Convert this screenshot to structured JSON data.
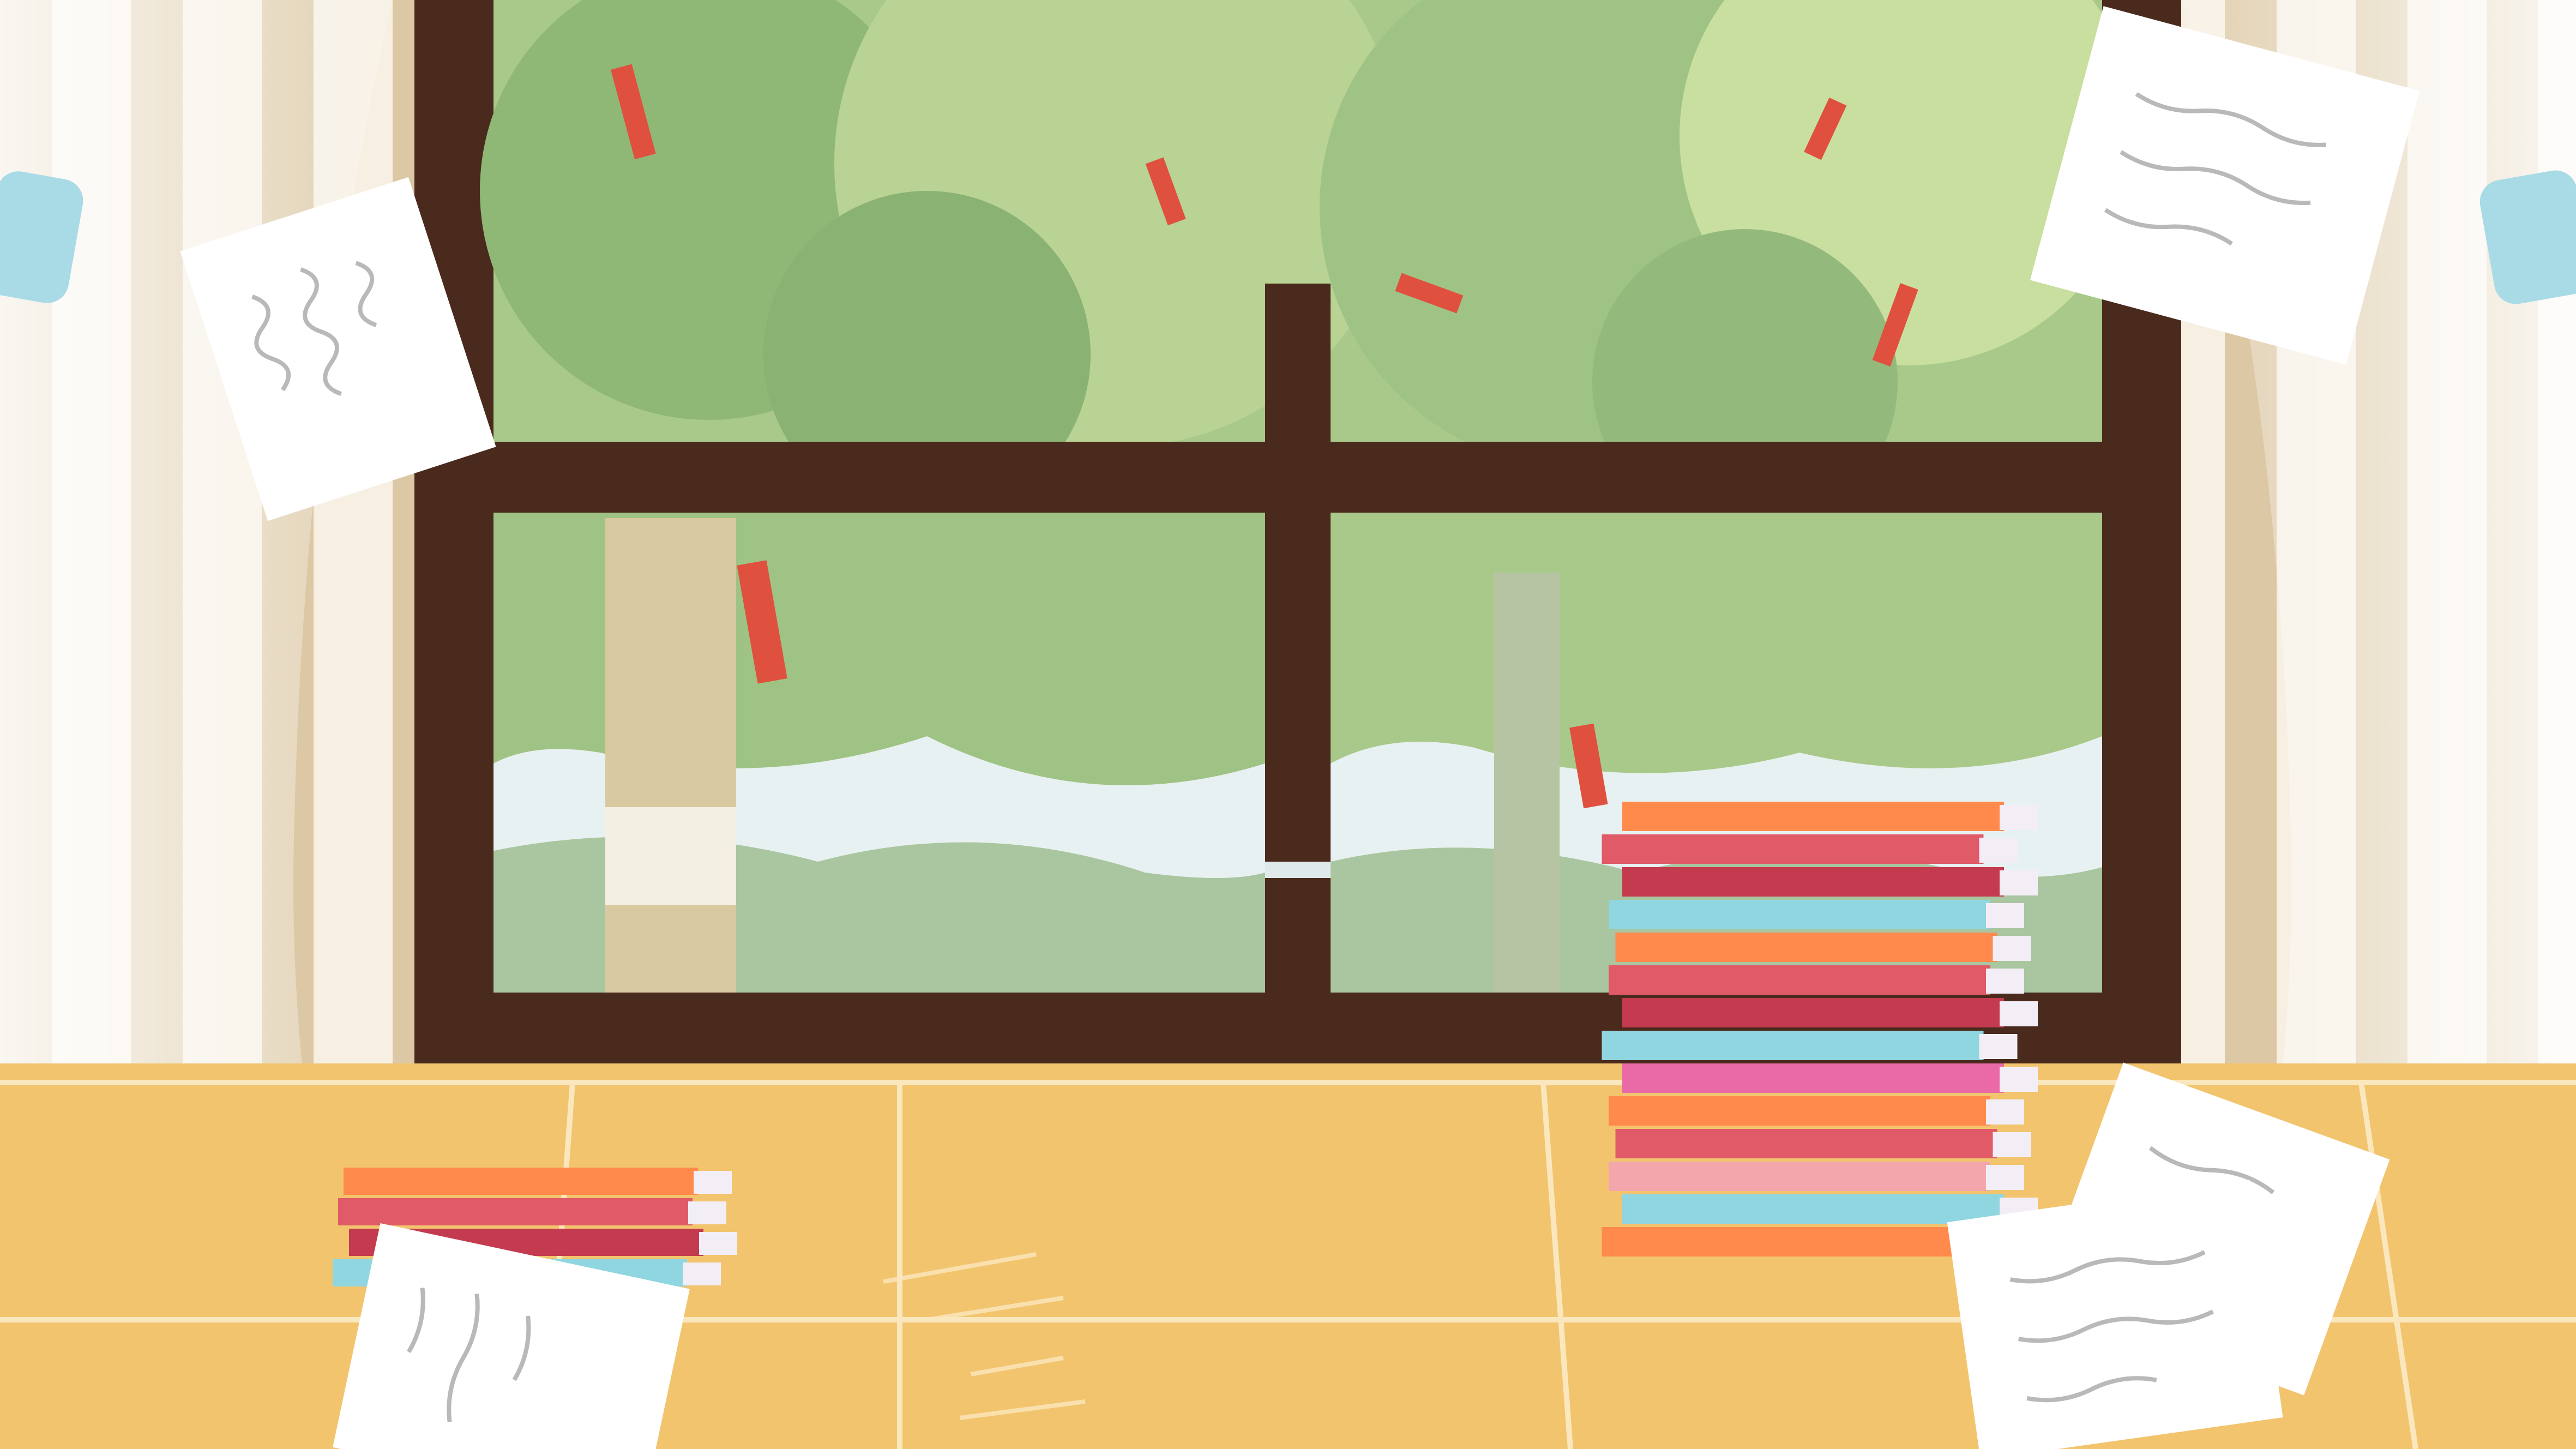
{
  "scene": {
    "description_free": true,
    "palette": {
      "wall_light": "#f6efe2",
      "wall_stripe": "#d9c4a0",
      "frame": "#4a2a1c",
      "glass_sky": "#e8f1f1",
      "foliage_dark": "#7fa86e",
      "foliage_mid": "#a8c98a",
      "foliage_light": "#cfe2a8",
      "trunk": "#d9c9a0",
      "ribbon": "#e0503e",
      "floor": "#f2c46e",
      "floor_line": "#fbe7bd",
      "curtain_tie": "#a9dbe6",
      "paper": "#ffffff",
      "paper_line": "#b9b9b9"
    },
    "book_colors_tall_stack": [
      "#ff8a4c",
      "#e05a68",
      "#c43a4e",
      "#8fd6e0",
      "#ff8a4c",
      "#e05a68",
      "#c43a4e",
      "#8fd6e0",
      "#e96aa6",
      "#ff8a4c",
      "#e05a68",
      "#f4a6ad",
      "#8fd6e0",
      "#ff8a4c"
    ],
    "book_colors_small_stack": [
      "#ff8a4c",
      "#e05a68",
      "#c43a4e",
      "#8fd6e0"
    ],
    "icons": [
      "window",
      "tree",
      "book-stack",
      "paper-sheet",
      "curtain"
    ]
  }
}
